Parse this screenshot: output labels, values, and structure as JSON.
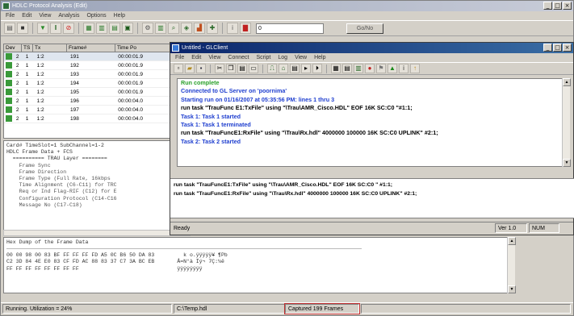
{
  "main_window": {
    "title": "HDLC Protocol Analysis (Edit)",
    "menu": [
      "File",
      "Edit",
      "View",
      "Analysis",
      "Options",
      "Help"
    ],
    "search_value": "0",
    "search_button": "Go/No",
    "grid": {
      "headers": [
        "Dev",
        "TS",
        "Tx",
        "Frame#",
        "Time Po"
      ],
      "rows": [
        {
          "dev": "2",
          "ts": "1",
          "tx": "1:2",
          "frame": "191",
          "time": "00:00:01.9"
        },
        {
          "dev": "2",
          "ts": "1",
          "tx": "1:2",
          "frame": "192",
          "time": "00:00:01.9"
        },
        {
          "dev": "2",
          "ts": "1",
          "tx": "1:2",
          "frame": "193",
          "time": "00:00:01.9"
        },
        {
          "dev": "2",
          "ts": "1",
          "tx": "1:2",
          "frame": "194",
          "time": "00:00:01.9"
        },
        {
          "dev": "2",
          "ts": "1",
          "tx": "1:2",
          "frame": "195",
          "time": "00:00:01.9"
        },
        {
          "dev": "2",
          "ts": "1",
          "tx": "1:2",
          "frame": "196",
          "time": "00:00:04.0"
        },
        {
          "dev": "2",
          "ts": "1",
          "tx": "1:2",
          "frame": "197",
          "time": "00:00:04.0"
        },
        {
          "dev": "2",
          "ts": "1",
          "tx": "1:2",
          "frame": "198",
          "time": "00:00:04.0"
        }
      ]
    },
    "detail_lines": [
      "Card# TimeSlot=1 SubChannel=1-2",
      "HDLC Frame Data + FCS",
      "  ========== TRAU Layer ========",
      "    Frame Sync",
      "    Frame Direction",
      "    Frame Type (Full Rate, 16kbps",
      "    Time Alignment (C6-C11) for TRC",
      "    Req or Ind Flag-RIF (C12) for E",
      "    Configuration Protocol (C14-C16",
      "    Message No (C17-C18)"
    ],
    "hex_title": "Hex Dump of the Frame Data",
    "hex_lines": [
      "00 00 98 00 83 BF FF FF FF FD A5 0C B6 50 DA 83",
      "C2 3D 84 4E E0 83 CF FD AC 88 83 37 C7 3A BC EB",
      "FF FF FF FF FF FF FF FF"
    ],
    "ascii_lines": [
      "  k o.ÿÿÿÿÿ¥ ¶Pb",
      "Â=N°à Ïý¬ 7Ç:¼ë",
      "ÿÿÿÿÿÿÿÿ"
    ],
    "status": {
      "utilization": "Running. Utilization = 24%",
      "file": "C:\\Temp.hdl",
      "captured": "Captured 199 Frames"
    }
  },
  "client_window": {
    "title": "Untitled - GLClient",
    "menu": [
      "File",
      "Edit",
      "View",
      "Connect",
      "Script",
      "Log",
      "View",
      "Help"
    ],
    "output_lines": [
      {
        "text": "Run complete",
        "color": "green"
      },
      {
        "text": "",
        "color": "black"
      },
      {
        "text": "Connected to GL Server on 'poornima'",
        "color": "blue"
      },
      {
        "text": "Starting run on 01/16/2007 at 05:35:56 PM: lines 1 thru 3",
        "color": "blue"
      },
      {
        "text": "run task \"TrauFunc E1:TxFile\" using \"\\Trau\\AMR_Cisco.HDL\" EOF 16K SC:C0 \"#1:1;",
        "color": "black"
      },
      {
        "text": "Task 1: Task 1 started",
        "color": "blue"
      },
      {
        "text": "Task 1: Task 1 terminated",
        "color": "blue"
      },
      {
        "text": "run task \"TrauFuncE1:RxFile\" using \"\\Trau\\Rx.hdl\" 4000000 100000 16K SC:C0  UPLINK\" #2:1;",
        "color": "black"
      },
      {
        "text": "Task 2: Task 2 started",
        "color": "blue"
      }
    ],
    "script_lines": [
      "run task \"TrauFuncE1:TxFile\" using \"\\Trau\\AMR_Cisco.HDL\" EOF 16K SC:C0 \" #1:1;",
      "run task \"TrauFuncE1:RxFile\" using \"\\Trau\\Rx.hdl\" 4000000 100000 16K SC:C0  UPLINK\" #2:1;"
    ],
    "status": {
      "ready": "Ready",
      "position": "Ver 1.0",
      "mode": "NUM"
    }
  },
  "colors": {
    "active_title": "#0a246a",
    "inactive_title": "#9aa3b8",
    "output_green": "#2aa02a",
    "output_blue": "#1f3fcf",
    "captured_highlight": "#c03030"
  }
}
